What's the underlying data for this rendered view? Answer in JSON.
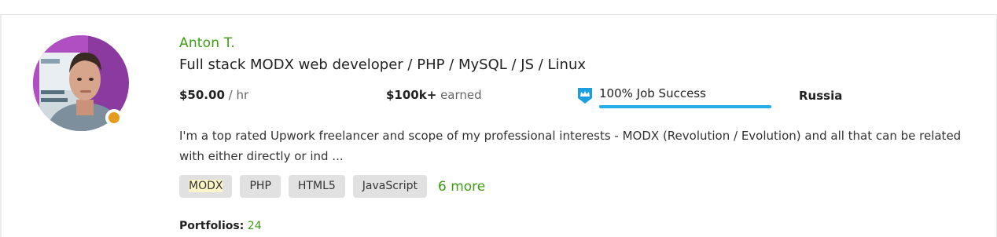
{
  "freelancer": {
    "name": "Anton T.",
    "title": "Full stack MODX web developer / PHP / MySQL / JS / Linux",
    "status_color": "#e59c1e"
  },
  "stats": {
    "rate_value": "$50.00",
    "rate_unit": "/ hr",
    "earned_value": "$100k+",
    "earned_label": "earned",
    "job_success_label": "100% Job Success",
    "job_success_fraction": 1.0,
    "country": "Russia"
  },
  "description": "I'm a top rated Upwork freelancer and scope of my professional interests - MODX (Revolution / Evolution) and all that can be related with either directly or ind ...",
  "skills": [
    "MODX",
    "PHP",
    "HTML5",
    "JavaScript"
  ],
  "more_skills": "6 more",
  "portfolios": {
    "label": "Portfolios:",
    "count": "24"
  },
  "colors": {
    "accent_green": "#3d9c14",
    "job_success_bar": "#22b0e6",
    "badge_blue": "#1a9ee0"
  }
}
